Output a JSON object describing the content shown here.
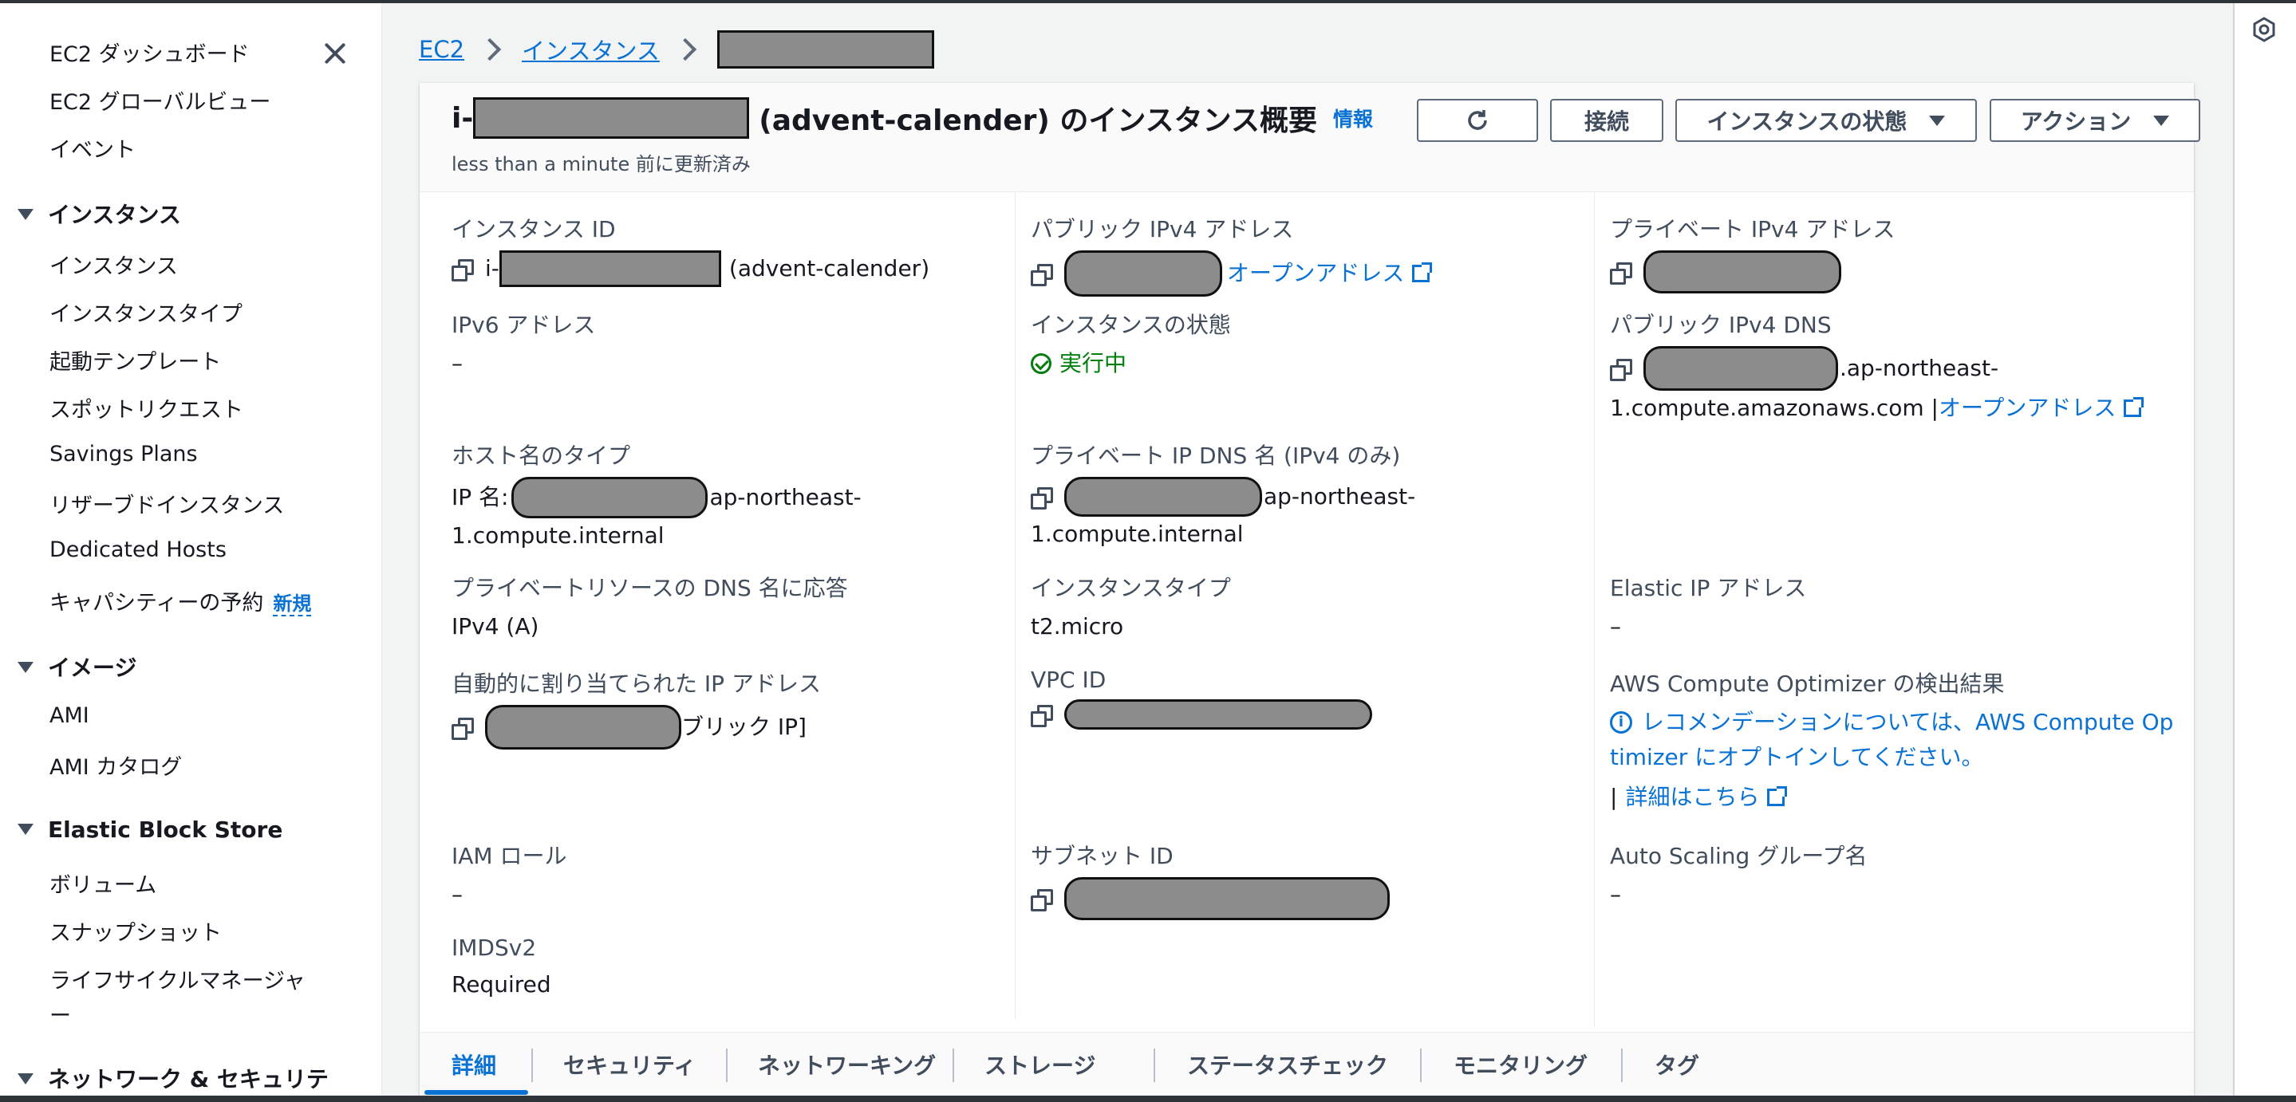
{
  "sidebar": {
    "top_items": [
      "EC2 ダッシュボード",
      "EC2 グローバルビュー",
      "イベント"
    ],
    "sections": [
      {
        "title": "インスタンス",
        "items": [
          "インスタンス",
          "インスタンスタイプ",
          "起動テンプレート",
          "スポットリクエスト",
          "Savings Plans",
          "リザーブドインスタンス",
          "Dedicated Hosts",
          "キャパシティーの予約"
        ],
        "new_badge": "新規"
      },
      {
        "title": "イメージ",
        "items": [
          "AMI",
          "AMI カタログ"
        ]
      },
      {
        "title": "Elastic Block Store",
        "items": [
          "ボリューム",
          "スナップショット",
          "ライフサイクルマネージャ",
          "ー"
        ]
      },
      {
        "title": "ネットワーク & セキュリテ"
      }
    ]
  },
  "breadcrumb": {
    "items": [
      "EC2",
      "インスタンス"
    ]
  },
  "header": {
    "title_prefix": "i-",
    "title_suffix": "(advent-calender) のインスタンス概要",
    "info": "情報",
    "updated": "less than a minute 前に更新済み",
    "buttons": {
      "connect": "接続",
      "instance_state": "インスタンスの状態",
      "actions": "アクション"
    }
  },
  "details": {
    "col1": {
      "instance_id": {
        "label": "インスタンス ID",
        "prefix": "i-",
        "suffix": "(advent-calender)"
      },
      "ipv6": {
        "label": "IPv6 アドレス",
        "value": "–"
      },
      "hostname_type": {
        "label": "ホスト名のタイプ",
        "prefix": "IP 名:",
        "suffix": "ap-northeast-",
        "line2": "1.compute.internal"
      },
      "dns_respond": {
        "label": "プライベートリソースの DNS 名に応答",
        "value": "IPv4 (A)"
      },
      "auto_ip": {
        "label": "自動的に割り当てられた IP アドレス",
        "suffix": "ブリック IP]"
      },
      "iam_role": {
        "label": "IAM ロール",
        "value": "–"
      },
      "imdsv2": {
        "label": "IMDSv2",
        "value": "Required"
      }
    },
    "col2": {
      "public_ipv4": {
        "label": "パブリック IPv4 アドレス",
        "link": "オープンアドレス"
      },
      "instance_state": {
        "label": "インスタンスの状態",
        "value": "実行中"
      },
      "private_dns": {
        "label": "プライベート IP DNS 名 (IPv4 のみ)",
        "suffix": "ap-northeast-",
        "line2": "1.compute.internal"
      },
      "instance_type": {
        "label": "インスタンスタイプ",
        "value": "t2.micro"
      },
      "vpc_id": {
        "label": "VPC ID"
      },
      "subnet_id": {
        "label": "サブネット ID"
      }
    },
    "col3": {
      "private_ipv4": {
        "label": "プライベート IPv4 アドレス"
      },
      "public_dns": {
        "label": "パブリック IPv4 DNS",
        "suffix": ".ap-northeast-",
        "line2": "1.compute.amazonaws.com |",
        "link": "オープンアドレス"
      },
      "elastic_ip": {
        "label": "Elastic IP アドレス",
        "value": "–"
      },
      "optimizer": {
        "label": "AWS Compute Optimizer の検出結果",
        "line1": "レコメンデーションについては、AWS Compute Op",
        "line2": "timizer にオプトインしてください。",
        "more_prefix": "|",
        "more": "詳細はこちら"
      },
      "asg": {
        "label": "Auto Scaling グループ名",
        "value": "–"
      }
    }
  },
  "tabs": [
    "詳細",
    "セキュリティ",
    "ネットワーキング",
    "ストレージ",
    "ステータスチェック",
    "モニタリング",
    "タグ"
  ]
}
